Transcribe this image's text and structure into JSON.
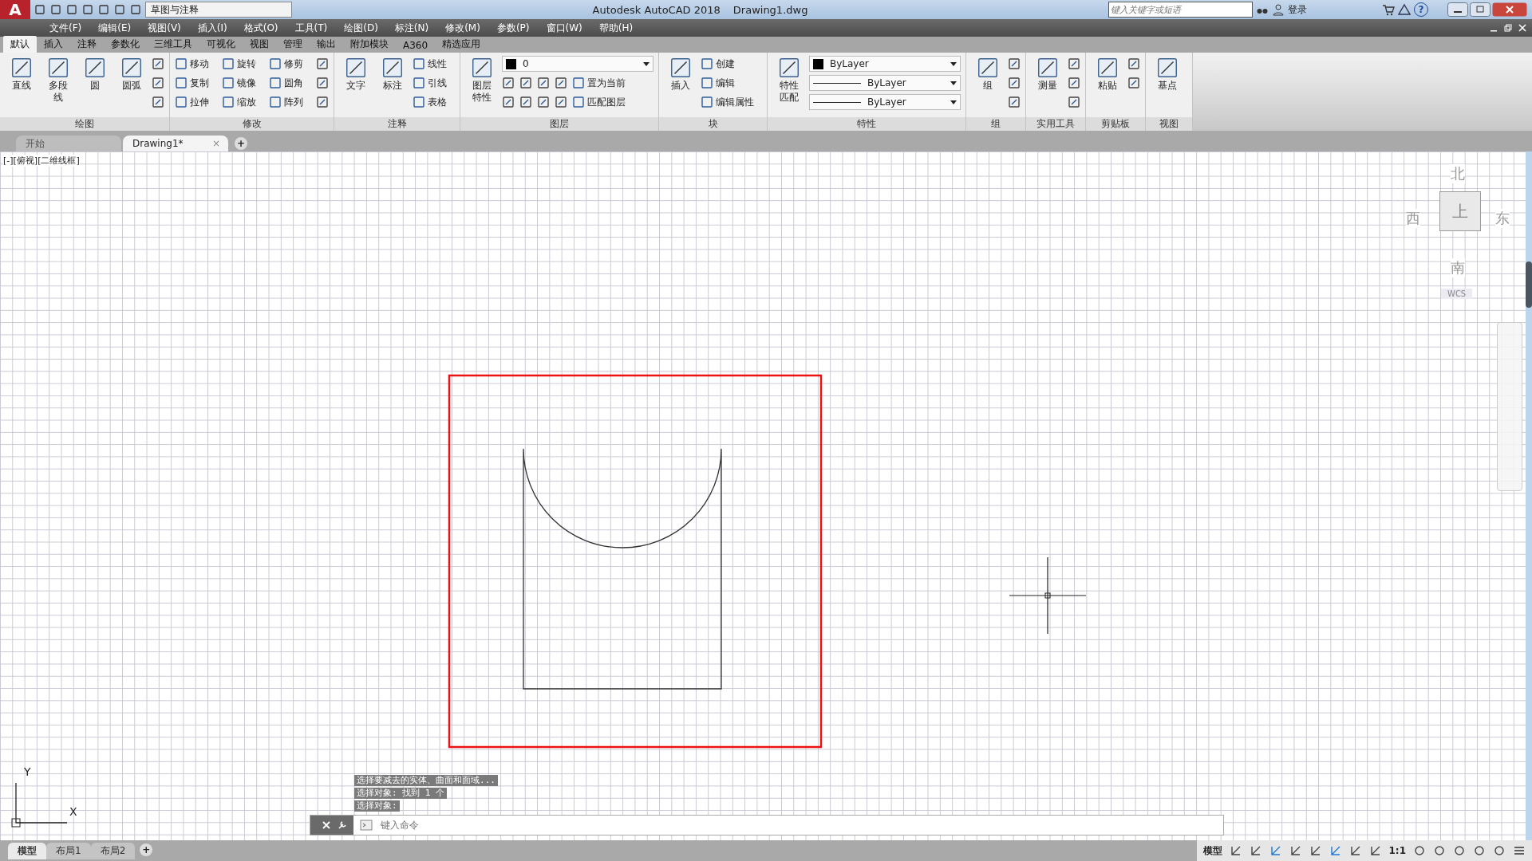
{
  "title_bar": {
    "logo": "A",
    "workspace": "草图与注释",
    "title": "Autodesk AutoCAD 2018",
    "document": "Drawing1.dwg",
    "search": {
      "placeholder": "键入关键字或短语"
    },
    "user": "登录",
    "help": "?"
  },
  "menu": [
    "文件(F)",
    "编辑(E)",
    "视图(V)",
    "插入(I)",
    "格式(O)",
    "工具(T)",
    "绘图(D)",
    "标注(N)",
    "修改(M)",
    "参数(P)",
    "窗口(W)",
    "帮助(H)"
  ],
  "ribbon_tabs": [
    {
      "label": "默认",
      "selected": true
    },
    {
      "label": "插入",
      "selected": false
    },
    {
      "label": "注释",
      "selected": false
    },
    {
      "label": "参数化",
      "selected": false
    },
    {
      "label": "三维工具",
      "selected": false
    },
    {
      "label": "可视化",
      "selected": false
    },
    {
      "label": "视图",
      "selected": false
    },
    {
      "label": "管理",
      "selected": false
    },
    {
      "label": "输出",
      "selected": false
    },
    {
      "label": "附加模块",
      "selected": false
    },
    {
      "label": "A360",
      "selected": false
    },
    {
      "label": "精选应用",
      "selected": false
    }
  ],
  "ribbon_panels": [
    {
      "title": "绘图",
      "large": [
        "直线",
        "多段线",
        "圆",
        "圆弧"
      ],
      "rows": [
        [
          {
            "kind": "icon"
          }
        ],
        [
          {
            "kind": "icon"
          }
        ],
        [
          {
            "kind": "icon"
          }
        ]
      ]
    },
    {
      "title": "修改",
      "rows": [
        [
          {
            "kind": "tool",
            "label": "移动"
          },
          {
            "kind": "tool",
            "label": "旋转"
          },
          {
            "kind": "tool",
            "label": "修剪"
          },
          {
            "kind": "icon"
          }
        ],
        [
          {
            "kind": "tool",
            "label": "复制"
          },
          {
            "kind": "tool",
            "label": "镜像"
          },
          {
            "kind": "tool",
            "label": "圆角"
          },
          {
            "kind": "icon"
          }
        ],
        [
          {
            "kind": "tool",
            "label": "拉伸"
          },
          {
            "kind": "tool",
            "label": "缩放"
          },
          {
            "kind": "tool",
            "label": "阵列"
          },
          {
            "kind": "icon"
          }
        ]
      ]
    },
    {
      "title": "注释",
      "large": [
        "文字",
        "标注"
      ],
      "rows": [
        [
          {
            "kind": "tool",
            "label": "线性"
          }
        ],
        [
          {
            "kind": "tool",
            "label": "引线"
          }
        ],
        [
          {
            "kind": "tool",
            "label": "表格"
          }
        ]
      ]
    },
    {
      "title": "图层",
      "large": [
        "图层特性"
      ],
      "dropdowns": [
        {
          "kind": "layer",
          "value": "0"
        }
      ],
      "rows": [
        [
          {
            "kind": "icon"
          },
          {
            "kind": "icon"
          },
          {
            "kind": "icon"
          },
          {
            "kind": "icon"
          },
          {
            "kind": "tool",
            "label": "置为当前"
          }
        ],
        [
          {
            "kind": "icon"
          },
          {
            "kind": "icon"
          },
          {
            "kind": "icon"
          },
          {
            "kind": "icon"
          },
          {
            "kind": "tool",
            "label": "匹配图层"
          }
        ]
      ]
    },
    {
      "title": "块",
      "large": [
        "插入"
      ],
      "rows": [
        [
          {
            "kind": "tool",
            "label": "创建"
          }
        ],
        [
          {
            "kind": "tool",
            "label": "编辑"
          }
        ],
        [
          {
            "kind": "tool",
            "label": "编辑属性"
          }
        ]
      ]
    },
    {
      "title": "特性",
      "large": [
        "特性匹配"
      ],
      "dropdowns": [
        {
          "kind": "color",
          "value": "ByLayer"
        },
        {
          "kind": "line",
          "value": "ByLayer"
        },
        {
          "kind": "line",
          "value": "ByLayer"
        }
      ]
    },
    {
      "title": "组",
      "large": [
        "组"
      ],
      "rows": [
        [
          {
            "kind": "icon"
          }
        ],
        [
          {
            "kind": "icon"
          }
        ],
        [
          {
            "kind": "icon"
          }
        ]
      ]
    },
    {
      "title": "实用工具",
      "large": [
        "测量"
      ],
      "rows": [
        [
          {
            "kind": "icon"
          }
        ],
        [
          {
            "kind": "icon"
          }
        ],
        [
          {
            "kind": "icon"
          }
        ]
      ]
    },
    {
      "title": "剪贴板",
      "large": [
        "粘贴"
      ],
      "rows": [
        [
          {
            "kind": "icon"
          }
        ],
        [
          {
            "kind": "icon"
          }
        ]
      ]
    },
    {
      "title": "视图",
      "large": [
        "基点"
      ]
    }
  ],
  "document_tabs": [
    {
      "label": "开始",
      "selected": false
    },
    {
      "label": "Drawing1*",
      "selected": true,
      "close": "×"
    }
  ],
  "new_tab": "+",
  "viewport": {
    "label": "[-][俯视][二维线框]",
    "viewcube": {
      "north": "北",
      "south": "南",
      "west": "西",
      "east": "东",
      "face": "上",
      "wcs": "WCS"
    },
    "ucs": {
      "x": "X",
      "y": "Y"
    }
  },
  "command": {
    "history": [
      "选择要减去的实体、曲面和面域...",
      "选择对象: 找到 1 个",
      "选择对象:"
    ],
    "placeholder": "键入命令"
  },
  "layout_tabs": [
    {
      "label": "模型",
      "selected": true
    },
    {
      "label": "布局1",
      "selected": false
    },
    {
      "label": "布局2",
      "selected": false
    }
  ],
  "new_layout": "+",
  "status_bar": {
    "space": "模型",
    "scale": "1:1"
  }
}
